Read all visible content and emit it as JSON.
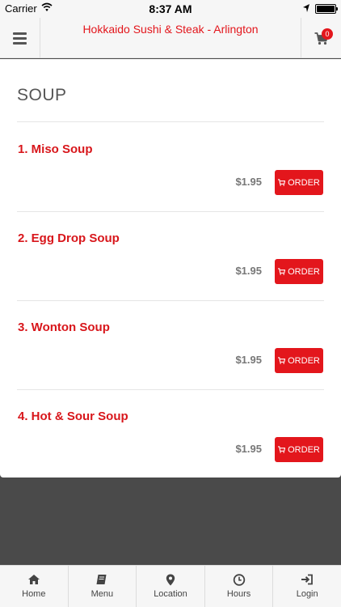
{
  "status_bar": {
    "carrier": "Carrier",
    "time": "8:37 AM"
  },
  "header": {
    "title": "Hokkaido Sushi & Steak - Arlington",
    "cart_count": "0"
  },
  "menu": {
    "section_title": "SOUP",
    "order_label": "ORDER",
    "items": [
      {
        "name": "1. Miso Soup",
        "price": "$1.95"
      },
      {
        "name": "2. Egg Drop Soup",
        "price": "$1.95"
      },
      {
        "name": "3. Wonton Soup",
        "price": "$1.95"
      },
      {
        "name": "4. Hot & Sour Soup",
        "price": "$1.95"
      }
    ]
  },
  "tabs": [
    {
      "label": "Home",
      "icon": "home-icon"
    },
    {
      "label": "Menu",
      "icon": "book-icon"
    },
    {
      "label": "Location",
      "icon": "map-marker-icon"
    },
    {
      "label": "Hours",
      "icon": "clock-icon"
    },
    {
      "label": "Login",
      "icon": "sign-in-icon"
    }
  ],
  "colors": {
    "accent": "#e3161c",
    "item_name": "#d8161b",
    "backdrop": "#4a4a4a"
  }
}
